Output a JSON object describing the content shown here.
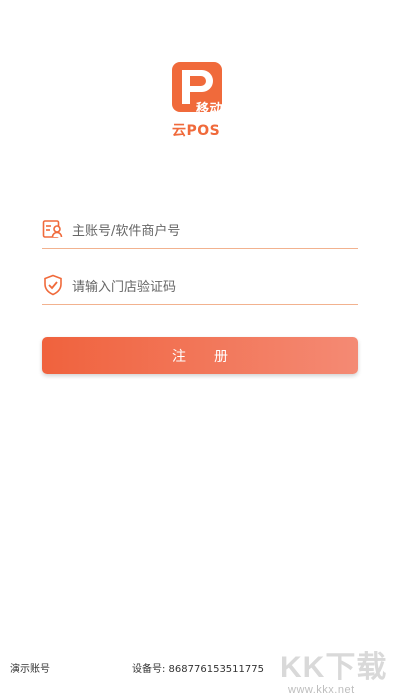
{
  "logo": {
    "badge_text": "移动",
    "brand_text": "云POS"
  },
  "form": {
    "account": {
      "placeholder": "主账号/软件商户号",
      "value": ""
    },
    "code": {
      "placeholder": "请输入门店验证码",
      "value": ""
    },
    "register_label": "注　　册"
  },
  "footer": {
    "demo_account": "演示账号",
    "device_label": "设备号: 868776153511775"
  },
  "watermark": {
    "big": "KK下载",
    "small": "www.kkx.net"
  },
  "colors": {
    "accent": "#f06a3b",
    "button_start": "#f0623d",
    "button_end": "#f48a74"
  },
  "icons": {
    "account": "account-card-icon",
    "code": "shield-check-icon"
  }
}
